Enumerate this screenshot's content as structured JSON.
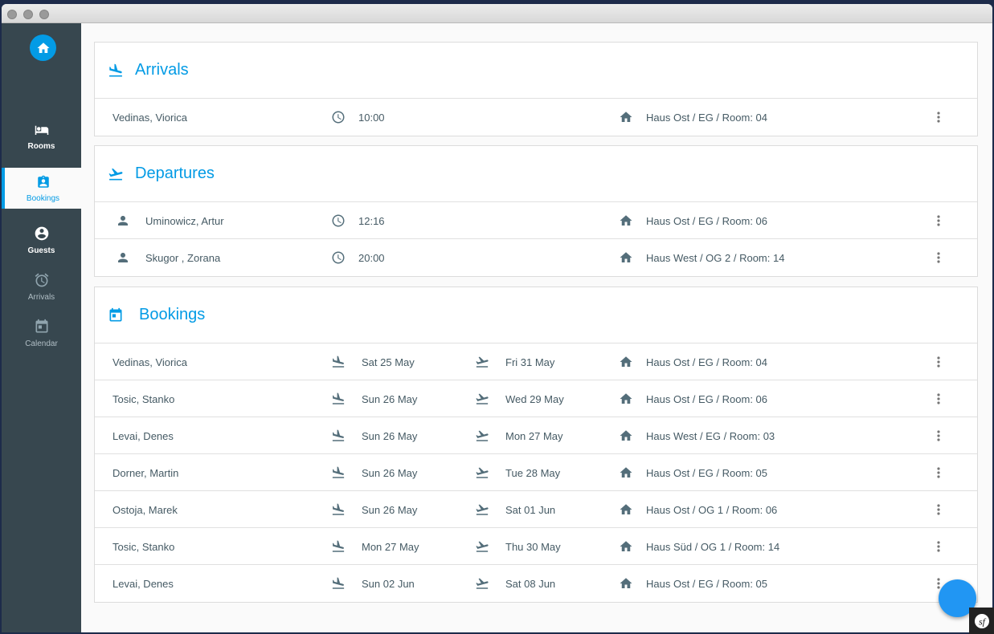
{
  "colors": {
    "accent": "#039be5",
    "sidebar": "#37474f",
    "text": "#455a64",
    "fab": "#2196f3"
  },
  "sidebar": {
    "home_icon": "home-icon",
    "items": [
      {
        "label": "Rooms",
        "icon": "bed-icon",
        "state": "normal"
      },
      {
        "label": "Bookings",
        "icon": "assignment-ind-icon",
        "state": "active"
      },
      {
        "label": "Guests",
        "icon": "account-circle-icon",
        "state": "normal"
      },
      {
        "label": "Arrivals",
        "icon": "alarm-icon",
        "state": "dim"
      },
      {
        "label": "Calendar",
        "icon": "calendar-icon",
        "state": "dim"
      }
    ]
  },
  "arrivals": {
    "title": "Arrivals",
    "rows": [
      {
        "name": "Vedinas, Viorica",
        "time": "10:00",
        "location": "Haus Ost / EG / Room: 04"
      }
    ]
  },
  "departures": {
    "title": "Departures",
    "rows": [
      {
        "name": "Uminowicz, Artur",
        "time": "12:16",
        "location": "Haus Ost / EG / Room: 06"
      },
      {
        "name": "Skugor , Zorana",
        "time": "20:00",
        "location": "Haus West / OG 2 / Room: 14"
      }
    ]
  },
  "bookings": {
    "title": "Bookings",
    "rows": [
      {
        "name": "Vedinas, Viorica",
        "arrival": "Sat 25 May",
        "departure": "Fri 31 May",
        "location": "Haus Ost / EG / Room: 04"
      },
      {
        "name": "Tosic, Stanko",
        "arrival": "Sun 26 May",
        "departure": "Wed 29 May",
        "location": "Haus Ost / EG / Room: 06"
      },
      {
        "name": "Levai, Denes",
        "arrival": "Sun 26 May",
        "departure": "Mon 27 May",
        "location": "Haus West / EG / Room: 03"
      },
      {
        "name": "Dorner, Martin",
        "arrival": "Sun 26 May",
        "departure": "Tue 28 May",
        "location": "Haus Ost / EG / Room: 05"
      },
      {
        "name": "Ostoja, Marek",
        "arrival": "Sun 26 May",
        "departure": "Sat 01 Jun",
        "location": "Haus Ost / OG 1 / Room: 06"
      },
      {
        "name": "Tosic, Stanko",
        "arrival": "Mon 27 May",
        "departure": "Thu 30 May",
        "location": "Haus Süd / OG 1 / Room: 14"
      },
      {
        "name": "Levai, Denes",
        "arrival": "Sun 02 Jun",
        "departure": "Sat 08 Jun",
        "location": "Haus Ost / EG / Room: 05"
      }
    ]
  }
}
